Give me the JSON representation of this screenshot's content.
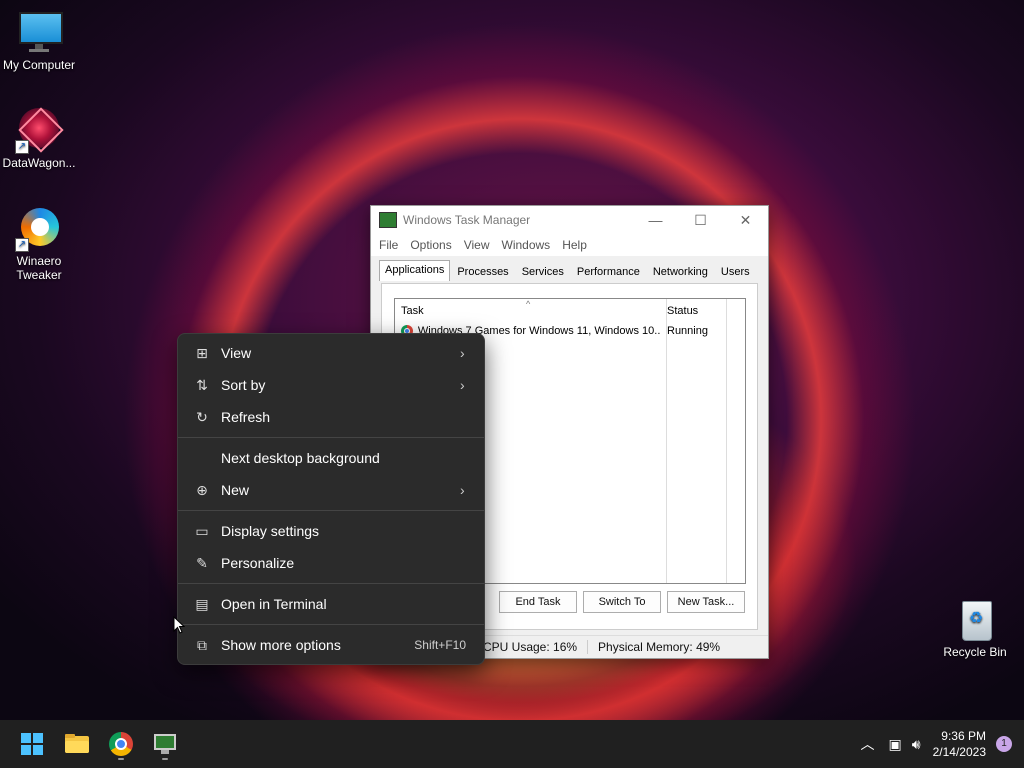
{
  "desktop": {
    "icons": [
      {
        "label": "My Computer"
      },
      {
        "label": "DataWagon..."
      },
      {
        "label": "Winaero Tweaker"
      },
      {
        "label": "Recycle Bin"
      }
    ]
  },
  "task_manager": {
    "title": "Windows Task Manager",
    "menu": [
      "File",
      "Options",
      "View",
      "Windows",
      "Help"
    ],
    "tabs": [
      "Applications",
      "Processes",
      "Services",
      "Performance",
      "Networking",
      "Users"
    ],
    "active_tab": "Applications",
    "columns": [
      "Task",
      "Status"
    ],
    "rows": [
      {
        "task": "Windows 7 Games for Windows 11, Windows 10...",
        "status": "Running"
      }
    ],
    "buttons": [
      "End Task",
      "Switch To",
      "New Task..."
    ],
    "status_bar": {
      "cpu": "CPU Usage: 16%",
      "memory": "Physical Memory: 49%"
    }
  },
  "context_menu": {
    "items": [
      {
        "label": "View",
        "icon": "grid-icon",
        "submenu": true
      },
      {
        "label": "Sort by",
        "icon": "sort-icon",
        "submenu": true
      },
      {
        "label": "Refresh",
        "icon": "refresh-icon"
      },
      {
        "label": "Next desktop background"
      },
      {
        "label": "New",
        "icon": "plus-circle-icon",
        "submenu": true
      },
      {
        "label": "Display settings",
        "icon": "display-icon"
      },
      {
        "label": "Personalize",
        "icon": "brush-icon"
      },
      {
        "label": "Open in Terminal",
        "icon": "terminal-icon"
      },
      {
        "label": "Show more options",
        "icon": "external-icon",
        "shortcut": "Shift+F10"
      }
    ]
  },
  "taskbar": {
    "apps": [
      "start-icon",
      "file-explorer-icon",
      "chrome-icon",
      "task-manager-icon"
    ],
    "time": "9:36 PM",
    "date": "2/14/2023",
    "notification_count": "1"
  }
}
